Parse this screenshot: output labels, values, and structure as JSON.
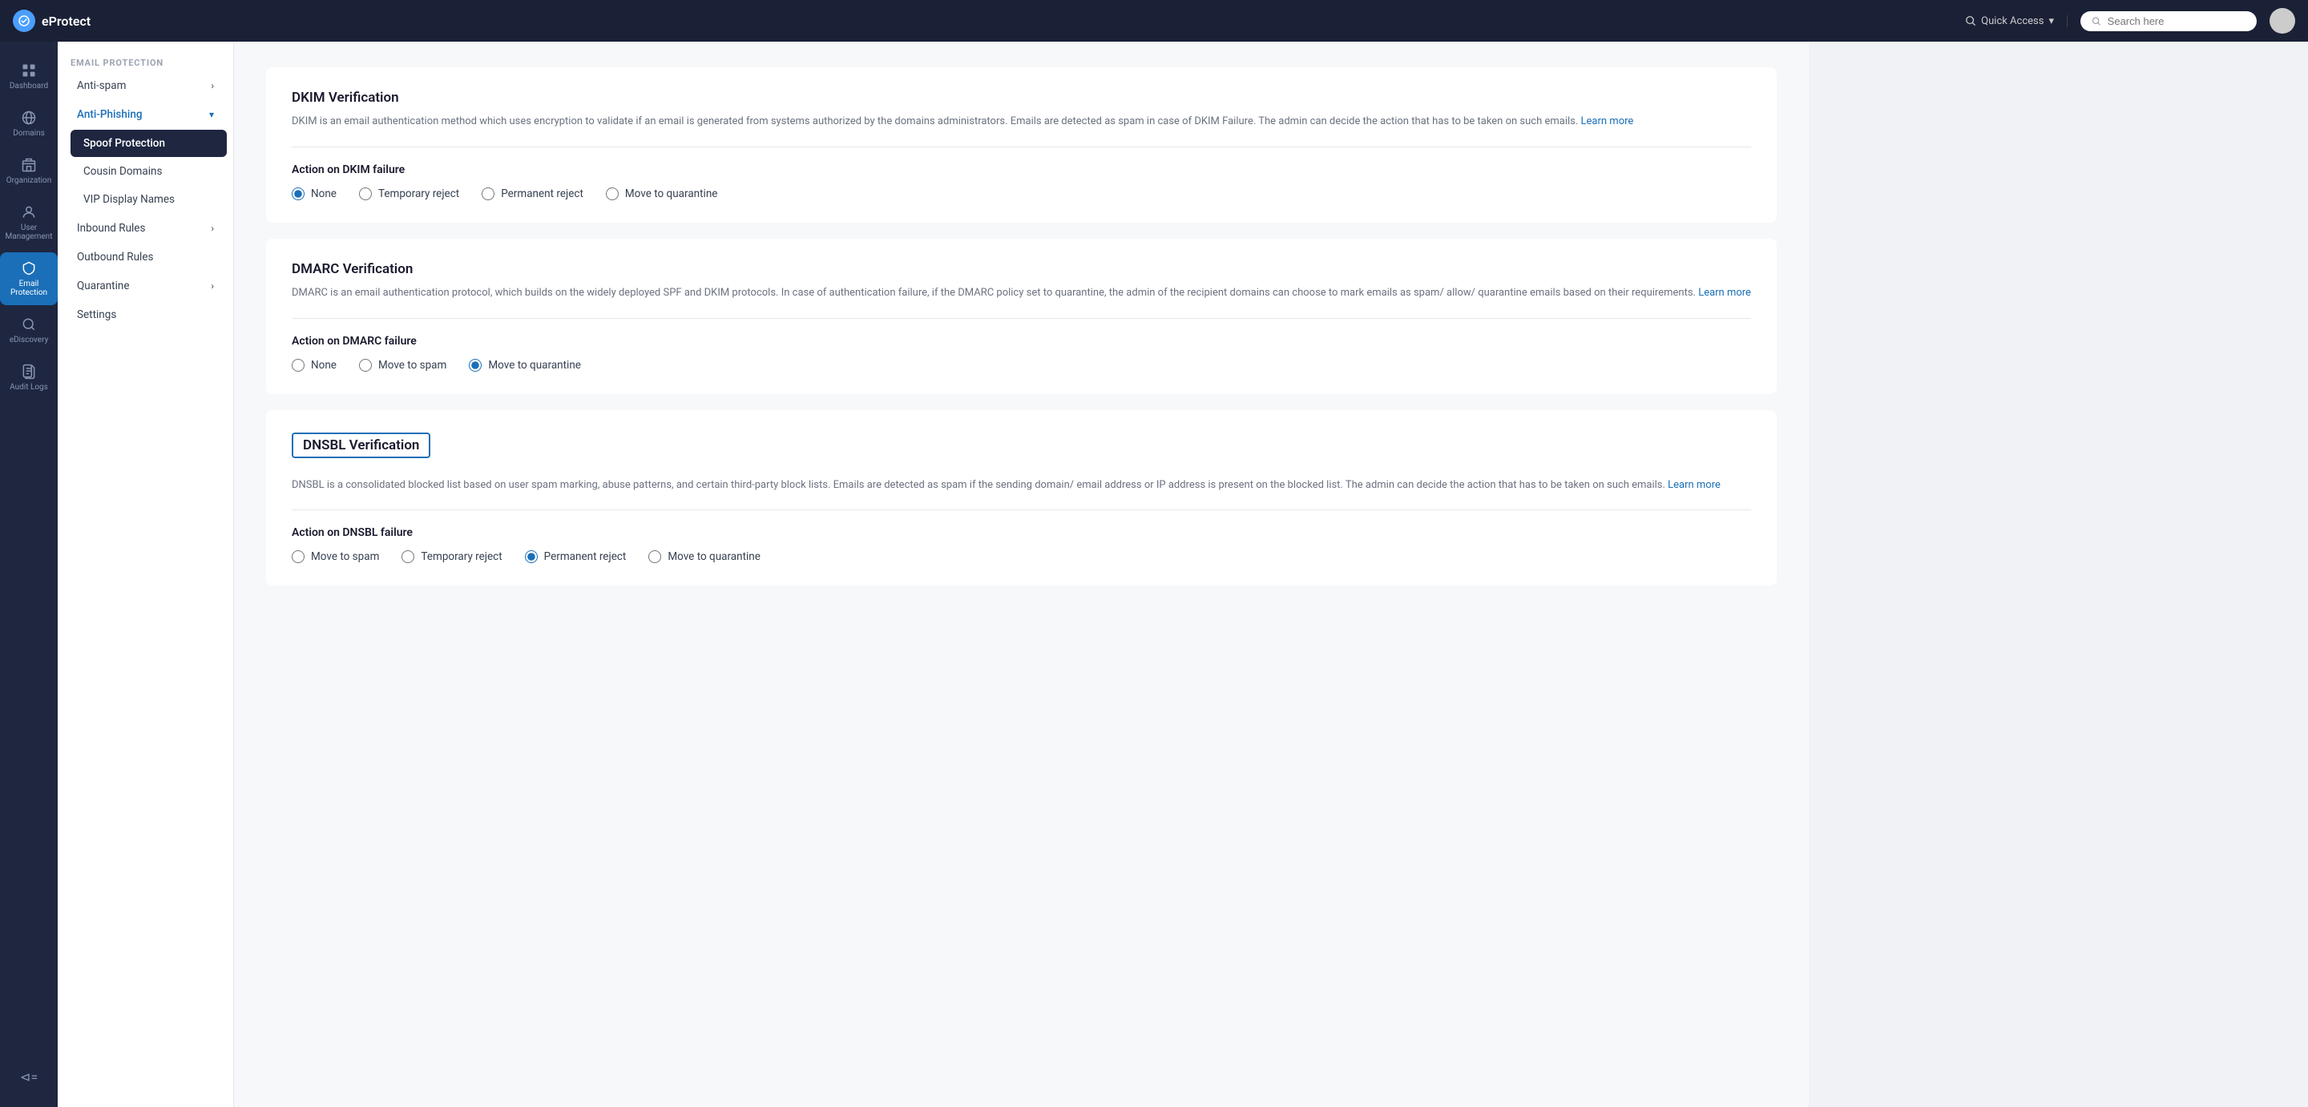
{
  "topbar": {
    "logo_text": "eProtect",
    "quick_access_label": "Quick Access",
    "search_placeholder": "Search here"
  },
  "icon_sidebar": {
    "items": [
      {
        "id": "dashboard",
        "label": "Dashboard",
        "icon": "grid"
      },
      {
        "id": "domains",
        "label": "Domains",
        "icon": "globe"
      },
      {
        "id": "organization",
        "label": "Organization",
        "icon": "building"
      },
      {
        "id": "user-management",
        "label": "User Management",
        "icon": "user"
      },
      {
        "id": "email-protection",
        "label": "Email Protection",
        "icon": "shield",
        "active": true
      },
      {
        "id": "ediscovery",
        "label": "eDiscovery",
        "icon": "search"
      },
      {
        "id": "audit-logs",
        "label": "Audit Logs",
        "icon": "file"
      }
    ],
    "collapse_label": "Collapse"
  },
  "nav_sidebar": {
    "section_title": "EMAIL PROTECTION",
    "items": [
      {
        "id": "anti-spam",
        "label": "Anti-spam",
        "has_arrow": true,
        "active": false
      },
      {
        "id": "anti-phishing",
        "label": "Anti-Phishing",
        "has_arrow": true,
        "active": true,
        "expanded": true
      },
      {
        "id": "spoof-protection",
        "label": "Spoof Protection",
        "sub": true,
        "selected": true
      },
      {
        "id": "cousin-domains",
        "label": "Cousin Domains",
        "sub": true
      },
      {
        "id": "vip-display-names",
        "label": "VIP Display Names",
        "sub": true
      },
      {
        "id": "inbound-rules",
        "label": "Inbound Rules",
        "has_arrow": true
      },
      {
        "id": "outbound-rules",
        "label": "Outbound Rules"
      },
      {
        "id": "quarantine",
        "label": "Quarantine",
        "has_arrow": true
      },
      {
        "id": "settings",
        "label": "Settings"
      }
    ]
  },
  "main": {
    "sections": [
      {
        "id": "dkim",
        "title": "DKIM Verification",
        "desc": "DKIM is an email authentication method which uses encryption to validate if an email is generated from systems authorized by the domains administrators. Emails are detected as spam in case of DKIM Failure. The admin can decide the action that has to be taken on such emails.",
        "learn_more": "Learn more",
        "action_title": "Action on DKIM failure",
        "options": [
          {
            "id": "dkim-none",
            "label": "None",
            "checked": true
          },
          {
            "id": "dkim-temp-reject",
            "label": "Temporary reject",
            "checked": false
          },
          {
            "id": "dkim-perm-reject",
            "label": "Permanent reject",
            "checked": false
          },
          {
            "id": "dkim-quarantine",
            "label": "Move to quarantine",
            "checked": false
          }
        ]
      },
      {
        "id": "dmarc",
        "title": "DMARC Verification",
        "desc": "DMARC is an email authentication protocol, which builds on the widely deployed SPF and DKIM protocols. In case of authentication failure, if the DMARC policy set to quarantine, the admin of the recipient domains can choose to mark emails as spam/ allow/ quarantine emails based on their requirements.",
        "learn_more": "Learn more",
        "action_title": "Action on DMARC failure",
        "options": [
          {
            "id": "dmarc-none",
            "label": "None",
            "checked": false
          },
          {
            "id": "dmarc-spam",
            "label": "Move to spam",
            "checked": false
          },
          {
            "id": "dmarc-quarantine",
            "label": "Move to quarantine",
            "checked": true
          }
        ]
      },
      {
        "id": "dnsbl",
        "title": "DNSBL Verification",
        "title_bordered": true,
        "desc": "DNSBL is a consolidated blocked list based on user spam marking, abuse patterns, and certain third-party block lists. Emails are detected as spam if the sending domain/ email address or IP address is present on the blocked list. The admin can decide the action that has to be taken on such emails.",
        "learn_more": "Learn more",
        "action_title": "Action on DNSBL failure",
        "options": [
          {
            "id": "dnsbl-spam",
            "label": "Move to spam",
            "checked": false
          },
          {
            "id": "dnsbl-temp-reject",
            "label": "Temporary reject",
            "checked": false
          },
          {
            "id": "dnsbl-perm-reject",
            "label": "Permanent reject",
            "checked": true
          },
          {
            "id": "dnsbl-quarantine",
            "label": "Move to quarantine",
            "checked": false
          }
        ]
      }
    ]
  },
  "colors": {
    "accent": "#1a6fb8",
    "sidebar_bg": "#1e2640",
    "active_icon_bg": "#1a6fb8"
  }
}
